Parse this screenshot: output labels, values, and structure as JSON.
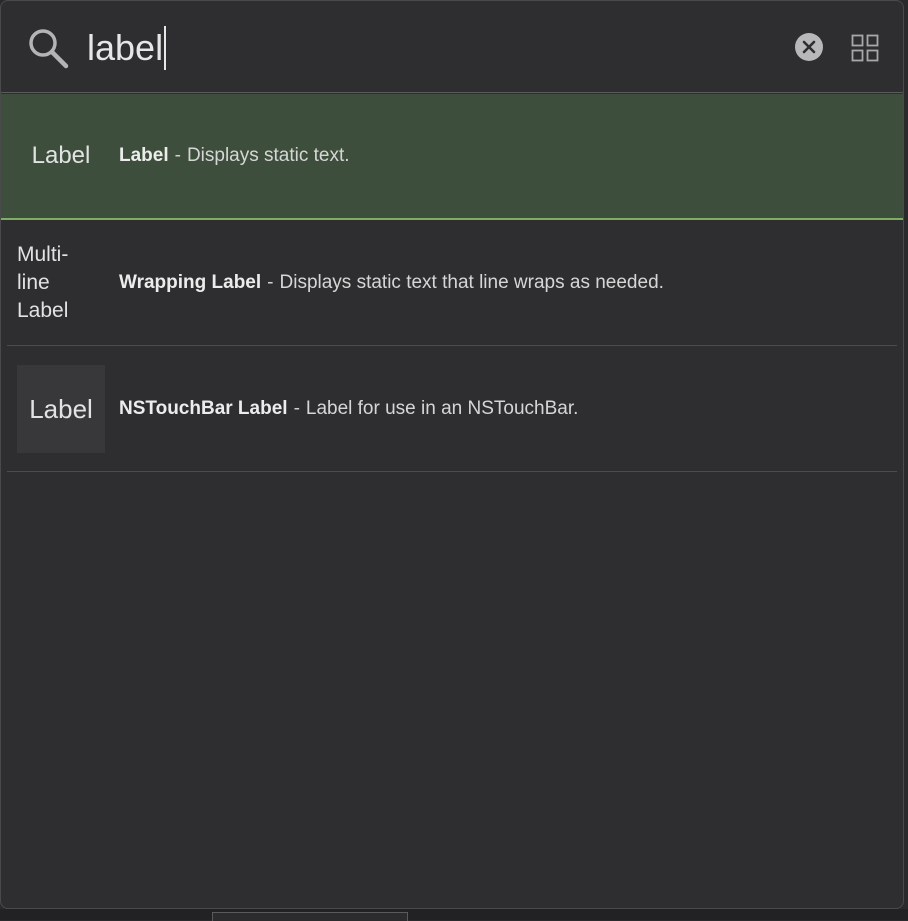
{
  "search": {
    "value": "label",
    "icon": "search-icon"
  },
  "toolbar": {
    "clear_icon": "close-circle-icon",
    "view_icon": "grid-view-icon"
  },
  "results": [
    {
      "preview": "Label",
      "title": "Label",
      "separator": "-",
      "description": "Displays static text.",
      "selected": true
    },
    {
      "preview_lines": [
        "Multi-",
        "line",
        "Label"
      ],
      "title": "Wrapping Label",
      "separator": "-",
      "description": "Displays static text that line wraps as needed.",
      "selected": false
    },
    {
      "preview": "Label",
      "title": "NSTouchBar Label",
      "separator": "-",
      "description": "Label for use in an NSTouchBar.",
      "selected": false
    }
  ],
  "colors": {
    "background": "#2e2e30",
    "selected_row": "#3e4e3c",
    "selected_accent": "#7fae63"
  }
}
